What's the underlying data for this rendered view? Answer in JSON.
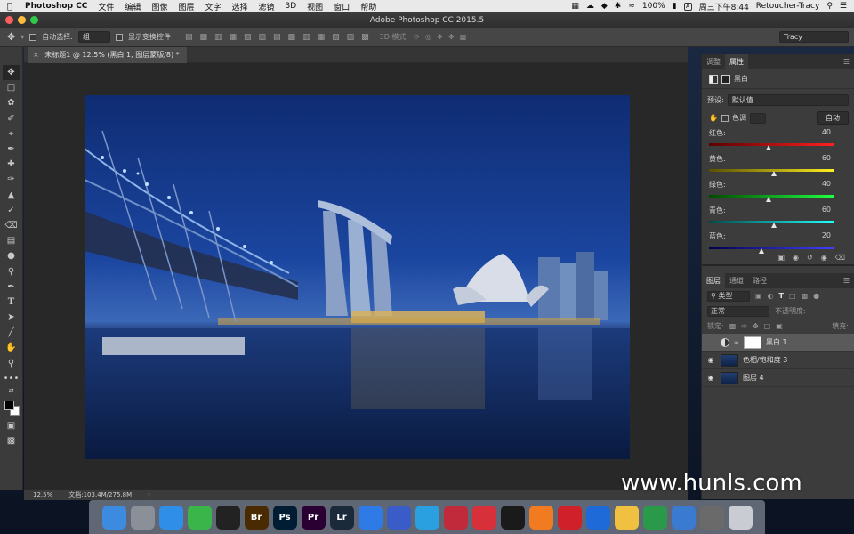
{
  "menubar": {
    "app_name": "Photoshop CC",
    "items": [
      "文件",
      "编辑",
      "图像",
      "图层",
      "文字",
      "选择",
      "滤镜",
      "3D",
      "视图",
      "窗口",
      "帮助"
    ],
    "battery": "100%",
    "time": "周三下午8:44",
    "user": "Retoucher-Tracy",
    "input_badge": "A"
  },
  "window": {
    "title": "Adobe Photoshop CC 2015.5"
  },
  "options": {
    "auto_select_label": "自动选择:",
    "auto_select_value": "组",
    "show_transform_label": "显示变换控件",
    "mode_3d_label": "3D 模式:",
    "workspace": "Tracy"
  },
  "document": {
    "tab_title": "未标题1 @ 12.5% (黑白 1, 图层蒙版/8) *",
    "zoom": "12.5%",
    "doc_size": "文档:103.4M/275.8M"
  },
  "properties_panel": {
    "tabs": [
      "调整",
      "属性"
    ],
    "adjustment_name": "黑白",
    "preset_label": "预设:",
    "preset_value": "默认值",
    "tint_label": "色调",
    "auto_label": "自动",
    "sliders": [
      {
        "name": "红色:",
        "value": "40",
        "fraction": 0.48,
        "gradient": "linear-gradient(90deg,#5a0000,#ff2020)"
      },
      {
        "name": "黄色:",
        "value": "60",
        "fraction": 0.52,
        "gradient": "linear-gradient(90deg,#5a5000,#ffee20)"
      },
      {
        "name": "绿色:",
        "value": "40",
        "fraction": 0.48,
        "gradient": "linear-gradient(90deg,#004a00,#20ff40)"
      },
      {
        "name": "青色:",
        "value": "60",
        "fraction": 0.52,
        "gradient": "linear-gradient(90deg,#004a4a,#20ffff)"
      },
      {
        "name": "蓝色:",
        "value": "20",
        "fraction": 0.42,
        "gradient": "linear-gradient(90deg,#00004a,#4040ff)"
      }
    ]
  },
  "layers_panel": {
    "tabs": [
      "图层",
      "通道",
      "路径"
    ],
    "filter_label": "类型",
    "blend_mode": "正常",
    "opacity_label": "不透明度:",
    "lock_label": "锁定:",
    "fill_label": "填充:",
    "layers": [
      {
        "name": "黑白 1",
        "kind": "adjustment",
        "selected": true,
        "visible": false
      },
      {
        "name": "色相/饱和度 3",
        "kind": "image",
        "selected": false,
        "visible": true
      },
      {
        "name": "图层 4",
        "kind": "image",
        "selected": false,
        "visible": true
      }
    ]
  },
  "watermark": "www.hunls.com",
  "dock": {
    "apps": [
      {
        "icon": "finder-icon",
        "label": "",
        "color": "#3d8be0"
      },
      {
        "icon": "launchpad-icon",
        "label": "",
        "color": "#8a8f98"
      },
      {
        "icon": "safari-icon",
        "label": "",
        "color": "#2f8fe8"
      },
      {
        "icon": "wechat-icon",
        "label": "",
        "color": "#39b54a"
      },
      {
        "icon": "qq-icon",
        "label": "",
        "color": "#222222"
      },
      {
        "icon": "bridge-icon",
        "label": "Br",
        "color": "#4a2a00"
      },
      {
        "icon": "photoshop-icon",
        "label": "Ps",
        "color": "#001d34"
      },
      {
        "icon": "premiere-icon",
        "label": "Pr",
        "color": "#2a0033"
      },
      {
        "icon": "lightroom-icon",
        "label": "Lr",
        "color": "#1b2a3a"
      },
      {
        "icon": "baidu-netdisk-icon",
        "label": "",
        "color": "#2e7be8"
      },
      {
        "icon": "photo-app-icon",
        "label": "",
        "color": "#3a5cc8"
      },
      {
        "icon": "info-app-icon",
        "label": "",
        "color": "#2aa0e0"
      },
      {
        "icon": "davinci-icon",
        "label": "",
        "color": "#c02a3a"
      },
      {
        "icon": "youku-icon",
        "label": "",
        "color": "#d8303a"
      },
      {
        "icon": "obs-icon",
        "label": "",
        "color": "#1a1a1a"
      },
      {
        "icon": "xiami-icon",
        "label": "",
        "color": "#f07b20"
      },
      {
        "icon": "netease-music-icon",
        "label": "",
        "color": "#d0202a"
      },
      {
        "icon": "qq-browser-icon",
        "label": "",
        "color": "#1e6ad8"
      },
      {
        "icon": "notes-icon",
        "label": "",
        "color": "#f0c040"
      },
      {
        "icon": "numbers-icon",
        "label": "",
        "color": "#2a9a4a"
      },
      {
        "icon": "keynote-icon",
        "label": "",
        "color": "#3a7ad0"
      },
      {
        "icon": "system-prefs-icon",
        "label": "",
        "color": "#6a6a6a"
      },
      {
        "icon": "trash-icon",
        "label": "",
        "color": "#c9ccd2"
      }
    ]
  }
}
